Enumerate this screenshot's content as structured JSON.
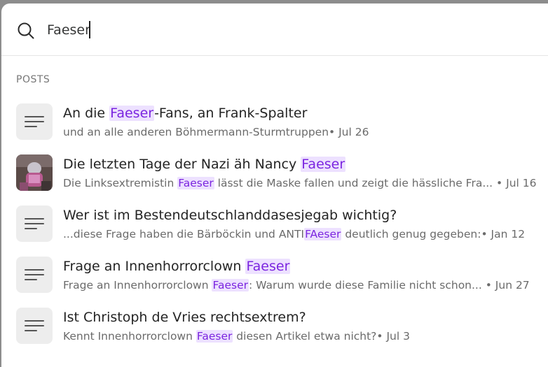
{
  "search": {
    "query": "Faeser",
    "placeholder": ""
  },
  "section": {
    "label": "POSTS"
  },
  "posts": [
    {
      "title": [
        "An die ",
        "Faeser",
        "-Fans, an Frank-Spalter"
      ],
      "subtitle": [
        "und an alle anderen Böhmermann-Sturmtruppen",
        "",
        ""
      ],
      "date": "• Jul 26",
      "thumbnail": "lines-icon"
    },
    {
      "title": [
        "Die letzten Tage der Nazi äh Nancy ",
        "Faeser",
        ""
      ],
      "subtitle": [
        "Die Linksextremistin ",
        "Faeser",
        " lässt die Maske fallen und zeigt die hässliche Fra..."
      ],
      "date": " • Jul 16",
      "thumbnail": "image"
    },
    {
      "title": [
        "Wer ist im Bestendeutschlanddasesjegab wichtig?",
        "",
        ""
      ],
      "subtitle": [
        "...diese Frage haben die Bärböckin und ANTI",
        "FAeser",
        " deutlich genug gegeben:"
      ],
      "date": "• Jan 12",
      "thumbnail": "lines-icon"
    },
    {
      "title": [
        "Frage an Innenhorrorclown ",
        "Faeser",
        ""
      ],
      "subtitle": [
        "Frage an Innenhorrorclown ",
        "Faeser",
        ": Warum wurde diese Familie nicht schon..."
      ],
      "date": " • Jun 27",
      "thumbnail": "lines-icon"
    },
    {
      "title": [
        "Ist Christoph de Vries rechtsextrem?",
        "",
        ""
      ],
      "subtitle": [
        "Kennt Innenhorrorclown ",
        "Faeser",
        " diesen Artikel etwa nicht?"
      ],
      "date": "• Jul 3",
      "thumbnail": "lines-icon"
    }
  ],
  "colors": {
    "highlight_bg": "#ede1ff",
    "highlight_text": "#7b25e0"
  }
}
